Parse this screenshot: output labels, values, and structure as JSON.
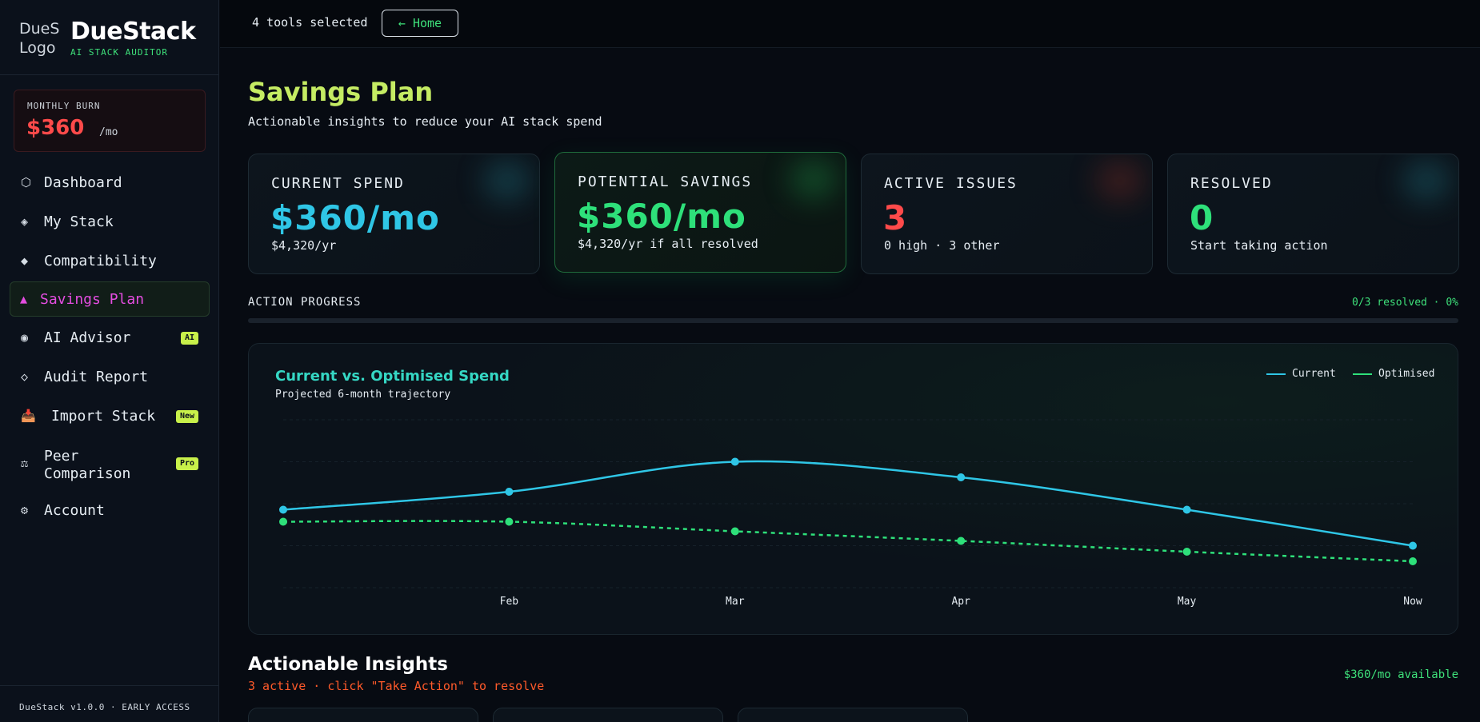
{
  "brand": {
    "logo_alt": "DueS Logo",
    "name": "DueStack",
    "tagline": "AI STACK AUDITOR"
  },
  "burn": {
    "label": "MONTHLY BURN",
    "value": "$360",
    "unit": "/mo"
  },
  "nav": [
    {
      "icon": "⬡",
      "label": "Dashboard"
    },
    {
      "icon": "◈",
      "label": "My Stack"
    },
    {
      "icon": "◆",
      "label": "Compatibility"
    },
    {
      "icon": "▲",
      "label": "Savings Plan"
    },
    {
      "icon": "◉",
      "label": "AI Advisor",
      "badge": "AI"
    },
    {
      "icon": "◇",
      "label": "Audit Report"
    },
    {
      "icon": "📥",
      "label": "Import Stack",
      "badge": "New"
    },
    {
      "icon": "⚖",
      "label": "Peer Comparison",
      "badge": "Pro"
    },
    {
      "icon": "⚙",
      "label": "Account"
    }
  ],
  "footer": {
    "version": "DueStack v1.0.0 · EARLY ACCESS"
  },
  "topbar": {
    "tools_selected": "4 tools selected",
    "home_button": "← Home"
  },
  "page": {
    "title": "Savings Plan",
    "subtitle": "Actionable insights to reduce your AI stack spend"
  },
  "stats": [
    {
      "label": "CURRENT SPEND",
      "value": "$360/mo",
      "sub": "$4,320/yr",
      "color": "#2fc6e6"
    },
    {
      "label": "POTENTIAL SAVINGS",
      "value": "$360/mo",
      "sub": "$4,320/yr if all resolved",
      "color": "#2ee07a"
    },
    {
      "label": "ACTIVE ISSUES",
      "value": "3",
      "sub": "0 high · 3 other",
      "color": "#ff4a4a"
    },
    {
      "label": "RESOLVED",
      "value": "0",
      "sub": "Start taking action",
      "color": "#2ee07a"
    }
  ],
  "progress": {
    "label": "ACTION PROGRESS",
    "count": "0/3 resolved · 0%",
    "fraction": 0
  },
  "chart_data": {
    "type": "line",
    "title": "Current vs. Optimised Spend",
    "subtitle": "Projected 6-month trajectory",
    "categories": [
      "",
      "Feb",
      "Mar",
      "Apr",
      "May",
      "Now"
    ],
    "series": [
      {
        "name": "Current",
        "values": [
          345,
          360,
          385,
          372,
          345,
          315
        ],
        "color": "#2fc6e6",
        "dashed": false
      },
      {
        "name": "Optimised",
        "values": [
          335,
          335,
          327,
          319,
          310,
          302
        ],
        "color": "#2ee07a",
        "dashed": true
      }
    ],
    "ylim": [
      280,
      420
    ],
    "grid": true,
    "legend": "top-right"
  },
  "insights": {
    "title": "Actionable Insights",
    "subtitle": "3 active · click \"Take Action\" to resolve",
    "available": "$360/mo available"
  }
}
